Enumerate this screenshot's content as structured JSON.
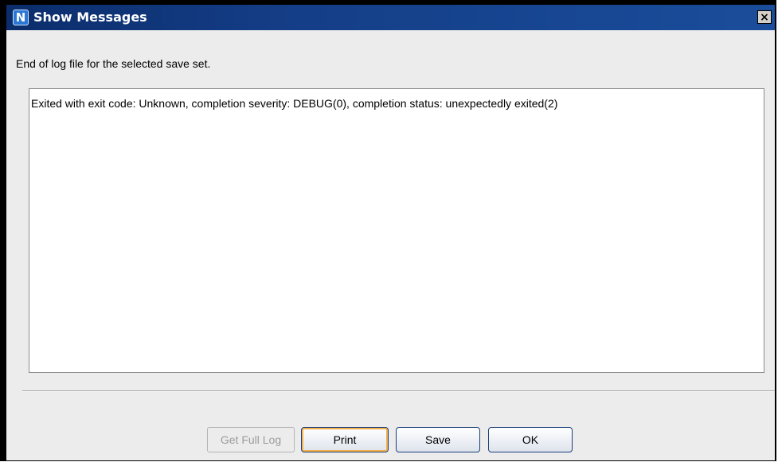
{
  "window": {
    "title": "Show Messages",
    "app_icon_letter": "N",
    "close_glyph": "×"
  },
  "intro_text": "End of log file for the selected save set.",
  "log": {
    "text": "Exited with exit code: Unknown, completion severity: DEBUG(0), completion status: unexpectedly exited(2)"
  },
  "buttons": {
    "get_full_log": "Get Full Log",
    "print": "Print",
    "save": "Save",
    "ok": "OK"
  },
  "colors": {
    "titlebar": "#0b2d6b",
    "focus_ring": "#f3b04d",
    "button_border": "#1c3f7a"
  }
}
